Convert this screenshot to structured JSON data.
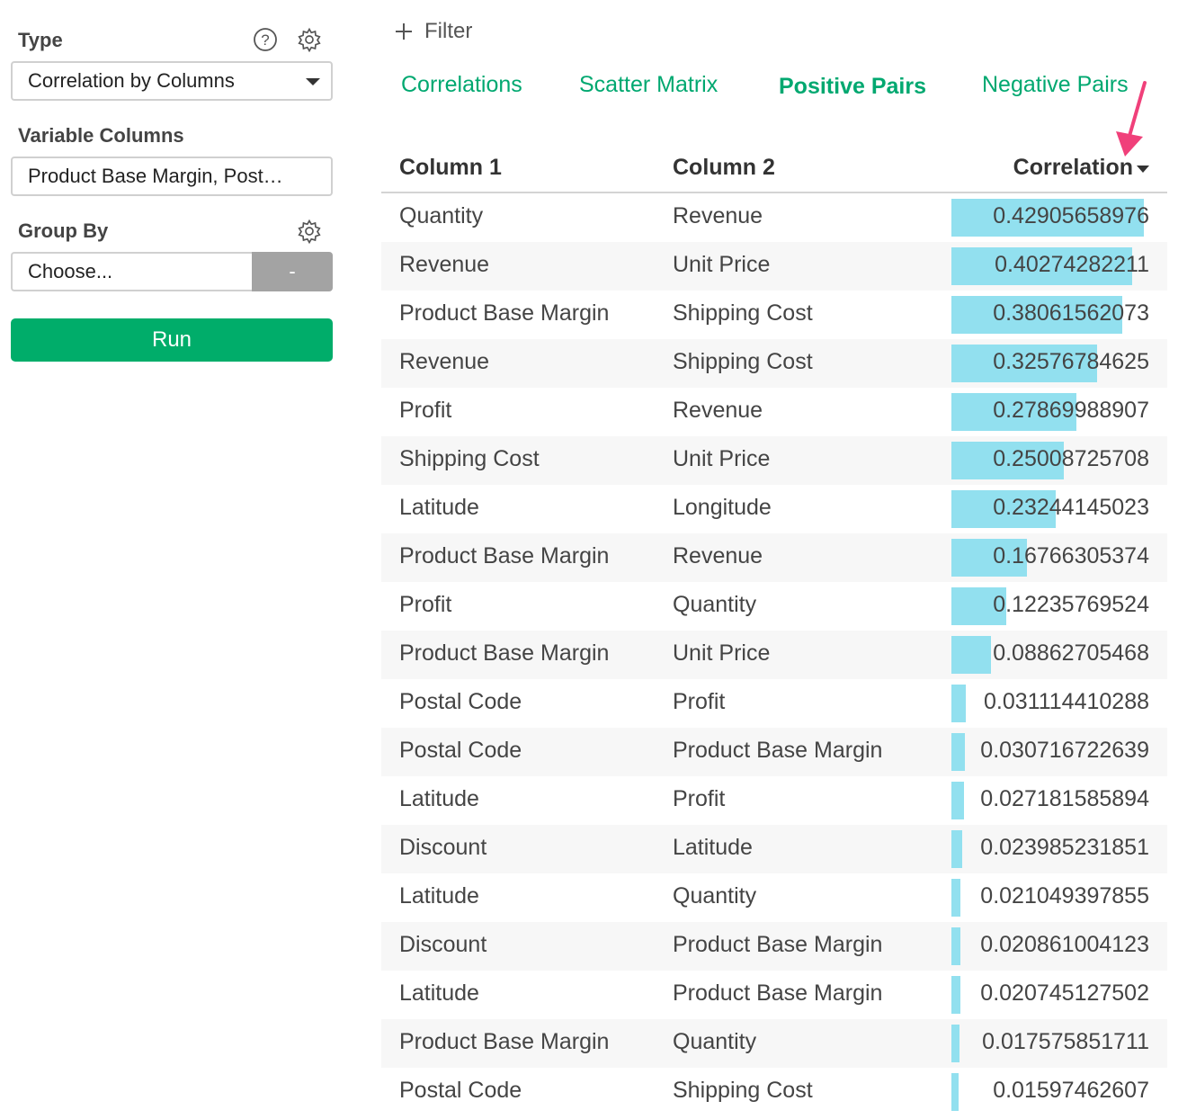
{
  "sidebar": {
    "type_label": "Type",
    "type_value": "Correlation by Columns",
    "variable_columns_label": "Variable Columns",
    "variable_columns_value": "Product Base Margin, Post…",
    "group_by_label": "Group By",
    "group_by_placeholder": "Choose...",
    "group_by_minus": "-",
    "run_label": "Run"
  },
  "filter": {
    "label": "Filter"
  },
  "tabs": [
    {
      "label": "Correlations"
    },
    {
      "label": "Scatter Matrix"
    },
    {
      "label": "Positive Pairs"
    },
    {
      "label": "Negative Pairs"
    }
  ],
  "active_tab": "Positive Pairs",
  "table": {
    "headers": {
      "col1": "Column 1",
      "col2": "Column 2",
      "corr": "Correlation"
    },
    "sort": "descending",
    "rows": [
      {
        "col1": "Quantity",
        "col2": "Revenue",
        "corr": "0.42905658976"
      },
      {
        "col1": "Revenue",
        "col2": "Unit Price",
        "corr": "0.40274282211"
      },
      {
        "col1": "Product Base Margin",
        "col2": "Shipping Cost",
        "corr": "0.38061562073"
      },
      {
        "col1": "Revenue",
        "col2": "Shipping Cost",
        "corr": "0.32576784625"
      },
      {
        "col1": "Profit",
        "col2": "Revenue",
        "corr": "0.27869988907"
      },
      {
        "col1": "Shipping Cost",
        "col2": "Unit Price",
        "corr": "0.25008725708"
      },
      {
        "col1": "Latitude",
        "col2": "Longitude",
        "corr": "0.23244145023"
      },
      {
        "col1": "Product Base Margin",
        "col2": "Revenue",
        "corr": "0.16766305374"
      },
      {
        "col1": "Profit",
        "col2": "Quantity",
        "corr": "0.12235769524"
      },
      {
        "col1": "Product Base Margin",
        "col2": "Unit Price",
        "corr": "0.08862705468"
      },
      {
        "col1": "Postal Code",
        "col2": "Profit",
        "corr": "0.031114410288"
      },
      {
        "col1": "Postal Code",
        "col2": "Product Base Margin",
        "corr": "0.030716722639"
      },
      {
        "col1": "Latitude",
        "col2": "Profit",
        "corr": "0.027181585894"
      },
      {
        "col1": "Discount",
        "col2": "Latitude",
        "corr": "0.023985231851"
      },
      {
        "col1": "Latitude",
        "col2": "Quantity",
        "corr": "0.021049397855"
      },
      {
        "col1": "Discount",
        "col2": "Product Base Margin",
        "corr": "0.020861004123"
      },
      {
        "col1": "Latitude",
        "col2": "Product Base Margin",
        "corr": "0.020745127502"
      },
      {
        "col1": "Product Base Margin",
        "col2": "Quantity",
        "corr": "0.017575851711"
      },
      {
        "col1": "Postal Code",
        "col2": "Shipping Cost",
        "corr": "0.01597462607"
      }
    ]
  },
  "colors": {
    "accent": "#00a870",
    "run_button": "#00ad6a",
    "bar": "#92e0ef",
    "annotation_arrow": "#f0407a"
  },
  "icons": [
    "help-icon",
    "gear-icon",
    "plus-icon",
    "caret-down-icon"
  ]
}
